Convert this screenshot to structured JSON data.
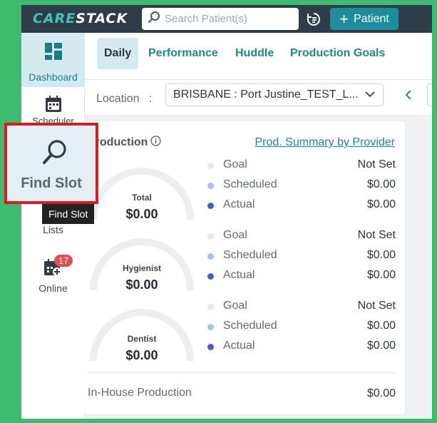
{
  "app": {
    "logo_part1": "CARE",
    "logo_part2": "STACK"
  },
  "header": {
    "search_placeholder": "Search Patient(s)",
    "add_patient_label": "Patient"
  },
  "nav": {
    "dashboard": "Dashboard",
    "scheduler": "Scheduler",
    "lists": "Lists",
    "online": "Online",
    "online_badge": "17"
  },
  "tabs": [
    "Daily",
    "Performance",
    "Huddle",
    "Production Goals"
  ],
  "location": {
    "label": "Location",
    "separator": ":",
    "value": "BRISBANE : Port Justine_TEST_L..."
  },
  "production": {
    "title": "Production",
    "link": "Prod. Summary by Provider",
    "groups": [
      {
        "label": "Total",
        "value": "$0.00",
        "rows": [
          {
            "name": "Goal",
            "value": "Not Set"
          },
          {
            "name": "Scheduled",
            "value": "$0.00"
          },
          {
            "name": "Actual",
            "value": "$0.00"
          }
        ]
      },
      {
        "label": "Hygienist",
        "value": "$0.00",
        "rows": [
          {
            "name": "Goal",
            "value": "Not Set"
          },
          {
            "name": "Scheduled",
            "value": "$0.00"
          },
          {
            "name": "Actual",
            "value": "$0.00"
          }
        ]
      },
      {
        "label": "Dentist",
        "value": "$0.00",
        "rows": [
          {
            "name": "Goal",
            "value": "Not Set"
          },
          {
            "name": "Scheduled",
            "value": "$0.00"
          },
          {
            "name": "Actual",
            "value": "$0.00"
          }
        ]
      }
    ],
    "in_house_label": "In-House Production",
    "in_house_value": "$0.00"
  },
  "find_slot": {
    "label": "Find Slot",
    "tooltip": "Find Slot"
  },
  "colors": {
    "goal_dot": "#e6e9ec",
    "scheduled_dot": "#a9bff0",
    "actual_dot": "#3d63c4",
    "accent": "#1f8597",
    "highlight_border": "#d91c1c"
  }
}
